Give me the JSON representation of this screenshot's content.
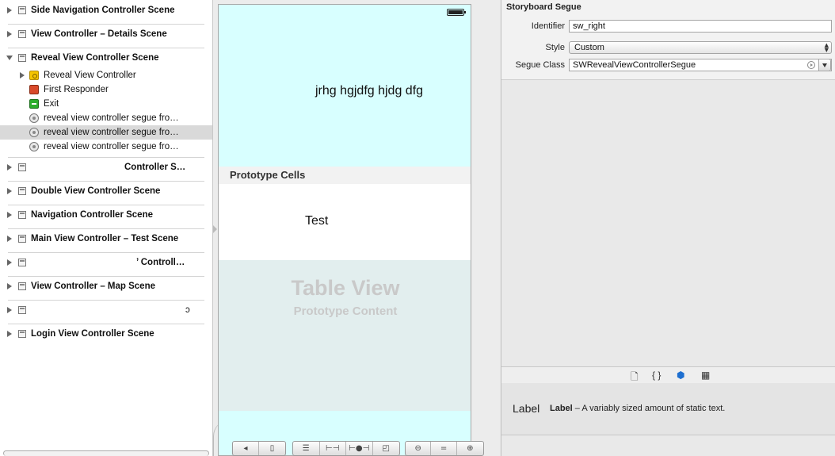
{
  "outline": {
    "scenes": [
      {
        "label": "Side Navigation Controller Scene"
      },
      {
        "label": "View Controller – Details Scene"
      },
      {
        "label": "Reveal View Controller Scene"
      },
      {
        "label": "Controller S…"
      },
      {
        "label": "Double View Controller Scene"
      },
      {
        "label": "Navigation Controller Scene"
      },
      {
        "label": "Main View Controller – Test Scene"
      },
      {
        "label": "’ Controll…"
      },
      {
        "label": "View Controller – Map Scene"
      },
      {
        "label": "ɔ"
      },
      {
        "label": "Login View Controller Scene"
      }
    ],
    "reveal_children": [
      {
        "label": "Reveal View Controller",
        "icon": "view-controller-icon"
      },
      {
        "label": "First Responder",
        "icon": "first-responder-icon"
      },
      {
        "label": "Exit",
        "icon": "exit-icon"
      },
      {
        "label": "reveal view controller segue fro…",
        "icon": "segue-icon"
      },
      {
        "label": "reveal view controller segue fro…",
        "icon": "segue-icon",
        "selected": true
      },
      {
        "label": "reveal view controller segue fro…",
        "icon": "segue-icon"
      }
    ]
  },
  "canvas": {
    "header_text": "jrhg hgjdfg hjdg dfg",
    "prototype_cells_label": "Prototype Cells",
    "cell_text": "Test",
    "table_view_title": "Table View",
    "table_view_subtitle": "Prototype Content"
  },
  "inspector": {
    "title": "Storyboard Segue",
    "identifier_label": "Identifier",
    "identifier_value": "sw_right",
    "style_label": "Style",
    "style_value": "Custom",
    "segue_class_label": "Segue Class",
    "segue_class_value": "SWRevealViewControllerSegue"
  },
  "library": {
    "item_title": "Label",
    "item_name": "Label",
    "item_desc": " – A variably sized amount of static text."
  },
  "colors": {
    "canvas_background": "#d8ffff",
    "selection": "#d9d9d9",
    "table_view_background": "#e2eeee"
  }
}
